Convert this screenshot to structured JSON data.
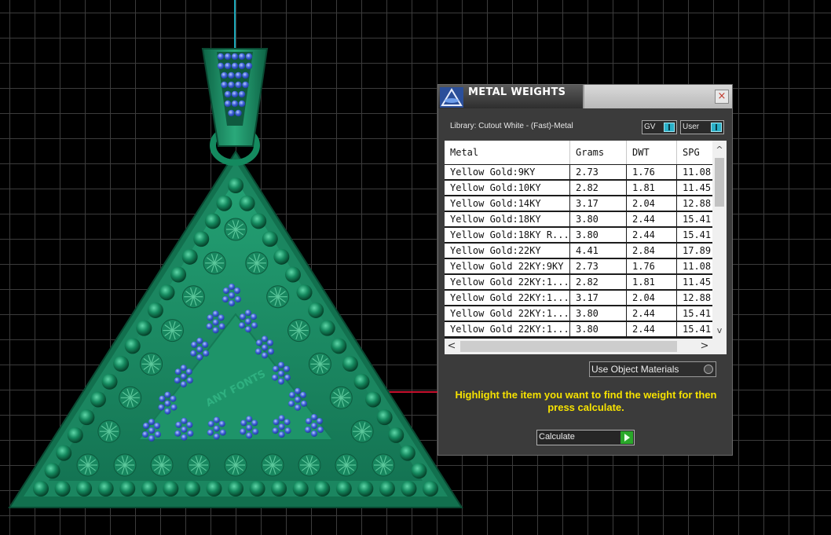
{
  "colors": {
    "metal_green": "#1d8a63",
    "gem_blue": "#3f63d8",
    "highlight_yellow": "#f6e200",
    "toggle_accent": "#2ab0c8"
  },
  "viewport": {
    "engraving_text": "ANY FONTS"
  },
  "dialog": {
    "title": "METAL WEIGHTS",
    "close_icon": "×",
    "library_label": "Library: Cutout White - (Fast)-Metal",
    "toggles": {
      "gv": "GV",
      "user": "User"
    },
    "table": {
      "columns": [
        "Metal",
        "Grams",
        "DWT",
        "SPG"
      ],
      "rows": [
        {
          "metal": "Yellow Gold:9KY",
          "grams": "2.73",
          "dwt": "1.76",
          "spg": "11.08"
        },
        {
          "metal": "Yellow Gold:10KY",
          "grams": "2.82",
          "dwt": "1.81",
          "spg": "11.45"
        },
        {
          "metal": "Yellow Gold:14KY",
          "grams": "3.17",
          "dwt": "2.04",
          "spg": "12.88"
        },
        {
          "metal": "Yellow Gold:18KY",
          "grams": "3.80",
          "dwt": "2.44",
          "spg": "15.41"
        },
        {
          "metal": "Yellow Gold:18KY R...",
          "grams": "3.80",
          "dwt": "2.44",
          "spg": "15.41"
        },
        {
          "metal": "Yellow Gold:22KY",
          "grams": "4.41",
          "dwt": "2.84",
          "spg": "17.89"
        },
        {
          "metal": "Yellow Gold 22KY:9KY",
          "grams": "2.73",
          "dwt": "1.76",
          "spg": "11.08"
        },
        {
          "metal": "Yellow Gold 22KY:1...",
          "grams": "2.82",
          "dwt": "1.81",
          "spg": "11.45"
        },
        {
          "metal": "Yellow Gold 22KY:1...",
          "grams": "3.17",
          "dwt": "2.04",
          "spg": "12.88"
        },
        {
          "metal": "Yellow Gold 22KY:1...",
          "grams": "3.80",
          "dwt": "2.44",
          "spg": "15.41"
        },
        {
          "metal": "Yellow Gold 22KY:1...",
          "grams": "3.80",
          "dwt": "2.44",
          "spg": "15.41"
        }
      ]
    },
    "scroll_icons": {
      "up": "^",
      "down": "v",
      "left": "<",
      "right": ">"
    },
    "use_object_materials": "Use Object Materials",
    "instructions": "Highlight the item you want to find the weight for then press calculate.",
    "calculate_label": "Calculate"
  }
}
